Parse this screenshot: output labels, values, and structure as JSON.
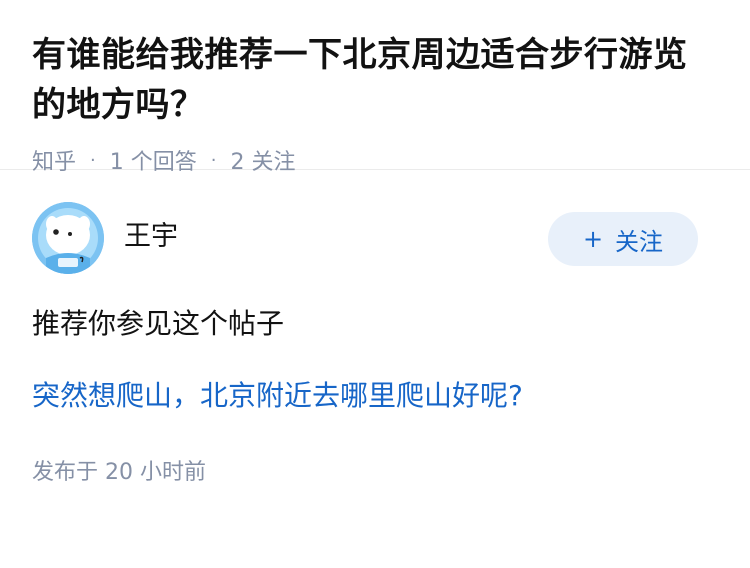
{
  "question": {
    "title": "有谁能给我推荐一下北京周边适合步行游览的地方吗？",
    "source": "知乎",
    "separator": "·",
    "answer_count": "1 个回答",
    "follow_count": "2 关注"
  },
  "answer": {
    "author": {
      "name": "王宇",
      "avatar_icon": "astronaut-dog-avatar"
    },
    "follow_button": {
      "plus": "+",
      "label": "关注"
    },
    "text": "推荐你参见这个帖子",
    "link_text": "突然想爬山，北京附近去哪里爬山好呢?",
    "published": "发布于  20 小时前"
  },
  "colors": {
    "link": "#1766c8",
    "meta": "#8590a6",
    "follow_bg": "#e8f0fa"
  }
}
